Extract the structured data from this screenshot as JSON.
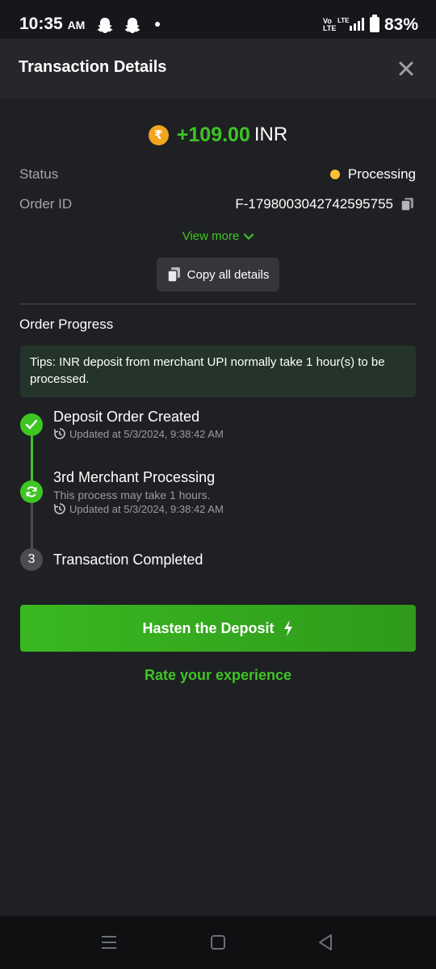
{
  "status_bar": {
    "time": "10:35",
    "ampm": "AM",
    "network": "Vo LTE",
    "lte": "LTE",
    "battery": "83%"
  },
  "header": {
    "title": "Transaction Details",
    "close_icon": "close-icon"
  },
  "amount": {
    "currency_symbol": "₹",
    "value": "+109.00",
    "currency": "INR"
  },
  "details": {
    "status_label": "Status",
    "status_value": "Processing",
    "status_color": "#f7c133",
    "order_label": "Order ID",
    "order_value": "F-1798003042742595755"
  },
  "actions": {
    "view_more": "View more",
    "copy_all": "Copy all details",
    "hasten": "Hasten the Deposit",
    "rate": "Rate your experience"
  },
  "progress": {
    "title": "Order Progress",
    "tips": "Tips: INR deposit from merchant UPI normally take 1 hour(s) to be processed.",
    "steps": [
      {
        "title": "Deposit Order Created",
        "updated": "Updated at 5/3/2024, 9:38:42 AM",
        "state": "done"
      },
      {
        "title": "3rd Merchant Processing",
        "note": "This process may take 1 hours.",
        "updated": "Updated at 5/3/2024, 9:38:42 AM",
        "state": "active"
      },
      {
        "number": "3",
        "title": "Transaction Completed",
        "state": "pending"
      }
    ]
  },
  "colors": {
    "accent": "#3ec524",
    "background": "#1f2023",
    "header": "#26272b"
  }
}
